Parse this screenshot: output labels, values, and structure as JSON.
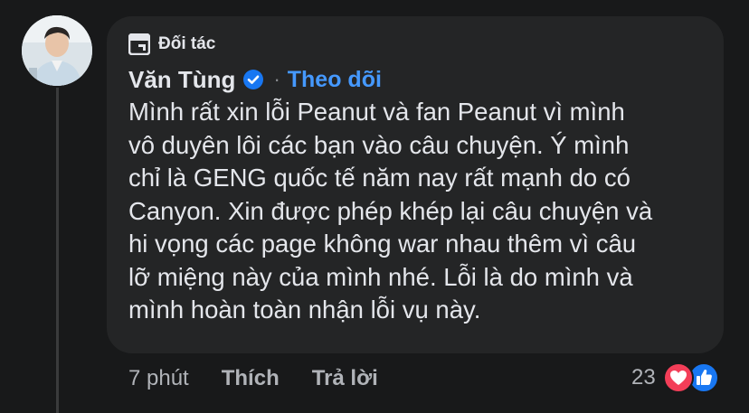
{
  "comment": {
    "badge_label": "Đối tác",
    "author_name": "Văn Tùng",
    "separator": "·",
    "follow_label": "Theo dõi",
    "text": "Mình rất xin lỗi Peanut và fan Peanut vì mình\nvô duyên lôi các bạn vào câu chuyện. Ý mình\nchỉ là GENG quốc tế năm nay rất mạnh do có\nCanyon. Xin được phép khép lại câu chuyện và\nhi vọng các page không war nhau thêm vì câu\nlỡ miệng này của mình nhé. Lỗi là do mình và\nmình hoàn toàn nhận lỗi vụ này."
  },
  "actions": {
    "time": "7 phút",
    "like_label": "Thích",
    "reply_label": "Trả lời"
  },
  "reactions": {
    "count": "23",
    "icons": [
      "love-icon",
      "like-icon"
    ]
  },
  "colors": {
    "background": "#18191a",
    "bubble": "#242526",
    "text_primary": "#e4e6eb",
    "text_secondary": "#b0b3b8",
    "link_blue": "#4599ff",
    "verified_blue": "#1877f2",
    "love_red": "#f33e58"
  }
}
